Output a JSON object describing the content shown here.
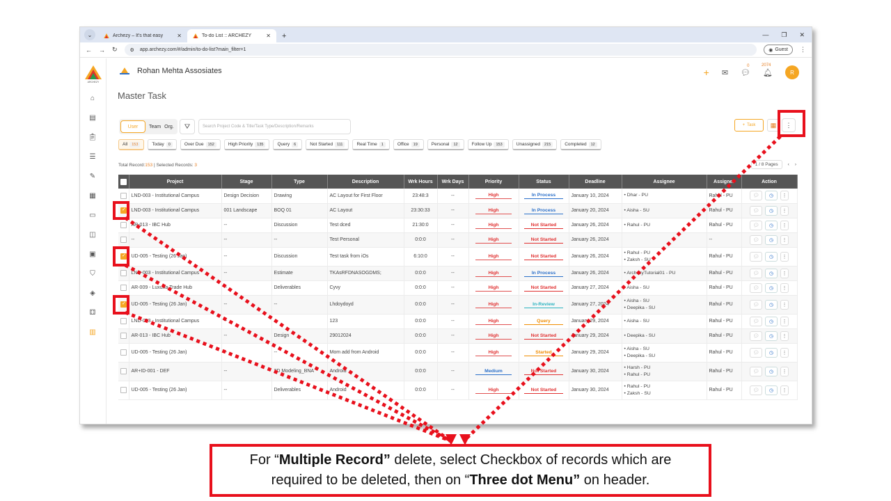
{
  "browser": {
    "tabs": [
      {
        "label": "Archezy – It's that easy",
        "active": false
      },
      {
        "label": "To-do List :: ARCHEZY",
        "active": true
      }
    ],
    "url": "app.archezy.com/#/admin/to-do-list?main_filter=1",
    "profile": "Guest"
  },
  "header": {
    "org_name": "Rohan Mehta Assosiates",
    "chat_badge": "0",
    "notif_badge": "2074",
    "avatar_initial": "R",
    "logo_text": "ARCHEZY"
  },
  "page": {
    "title": "Master Task",
    "toggle": [
      "User",
      "Team",
      "Org."
    ],
    "search_placeholder": "Search Project Code & Title/Task Type/Description/Remarks",
    "add_task": "Task",
    "filters": [
      {
        "label": "All",
        "count": "153",
        "active": true
      },
      {
        "label": "Today",
        "count": "0"
      },
      {
        "label": "Over Due",
        "count": "152"
      },
      {
        "label": "High Priority",
        "count": "135"
      },
      {
        "label": "Query",
        "count": "6"
      },
      {
        "label": "Not Started",
        "count": "111"
      },
      {
        "label": "Real Time",
        "count": "1"
      },
      {
        "label": "Office",
        "count": "19"
      },
      {
        "label": "Personal",
        "count": "12"
      },
      {
        "label": "Follow Up",
        "count": "153"
      },
      {
        "label": "Unassigned",
        "count": "215"
      },
      {
        "label": "Completed",
        "count": "12"
      }
    ],
    "total_label": "Total Record:",
    "total_value": "153",
    "selected_label": " | Selected Records: ",
    "selected_value": "3",
    "pager": "1 / 8 Pages"
  },
  "table": {
    "columns": [
      "Project",
      "Stage",
      "Type",
      "Description",
      "Wrk Hours",
      "Wrk Days",
      "Priority",
      "Status",
      "Deadline",
      "Assignee",
      "Assigner",
      "Action"
    ],
    "rows": [
      {
        "checked": false,
        "project": "LND-003 - Institutional Campus",
        "stage": "Design Decision",
        "type": "Drawing",
        "desc": "AC Layout for First Floor",
        "hours": "23:48:3",
        "days": "--",
        "priority": "High",
        "status": "In Process",
        "deadline": "January 10, 2024",
        "assignee": [
          "Dhar - PU"
        ],
        "assigner": "Rahul - PU"
      },
      {
        "checked": true,
        "project": "LND-003 - Institutional Campus",
        "stage": "001 Landscape",
        "type": "BOQ 01",
        "desc": "AC Layout",
        "hours": "23:30:33",
        "days": "--",
        "priority": "High",
        "status": "In Process",
        "deadline": "January 20, 2024",
        "assignee": [
          "Aisha - SU"
        ],
        "assigner": "Rahul - PU"
      },
      {
        "checked": false,
        "project": "AR-013 - IBC Hub",
        "stage": "--",
        "type": "Discussion",
        "desc": "Test dced",
        "hours": "21:30:0",
        "days": "--",
        "priority": "High",
        "status": "Not Started",
        "deadline": "January 26, 2024",
        "assignee": [
          "Rahul - PU"
        ],
        "assigner": "Rahul - PU"
      },
      {
        "checked": false,
        "project": "--",
        "stage": "--",
        "type": "--",
        "desc": "Test Personal",
        "hours": "0:0:0",
        "days": "--",
        "priority": "High",
        "status": "Not Started",
        "deadline": "January 26, 2024",
        "assignee": [],
        "assigner": "--"
      },
      {
        "checked": true,
        "project": "UD-005 - Testing (26 Jan)",
        "stage": "--",
        "type": "Discussion",
        "desc": "Test task from iOs",
        "hours": "6:10:0",
        "days": "--",
        "priority": "High",
        "status": "Not Started",
        "deadline": "January 26, 2024",
        "assignee": [
          "Rahul - PU",
          "Zaksh - SU"
        ],
        "assigner": "Rahul - PU"
      },
      {
        "checked": false,
        "project": "LND-003 - Institutional Campus",
        "stage": "--",
        "type": "Estimate",
        "desc": "TKAsRFDNASOGDMS;",
        "hours": "0:0:0",
        "days": "--",
        "priority": "High",
        "status": "In Process",
        "deadline": "January 26, 2024",
        "assignee": [
          "ArchezyTutorial01 - PU"
        ],
        "assigner": "Rahul - PU"
      },
      {
        "checked": false,
        "project": "AR-009 - Luxuria Trade Hub",
        "stage": "--",
        "type": "Deliverables",
        "desc": "Cyvy",
        "hours": "0:0:0",
        "days": "--",
        "priority": "High",
        "status": "Not Started",
        "deadline": "January 27, 2024",
        "assignee": [
          "Aisha - SU"
        ],
        "assigner": "Rahul - PU"
      },
      {
        "checked": true,
        "project": "UD-005 - Testing (26 Jan)",
        "stage": "--",
        "type": "--",
        "desc": "Lhdoydoyd",
        "hours": "0:0:0",
        "days": "--",
        "priority": "High",
        "status": "In-Review",
        "deadline": "January 27, 2024",
        "assignee": [
          "Aisha - SU",
          "Deepika - SU"
        ],
        "assigner": "Rahul - PU"
      },
      {
        "checked": false,
        "project": "LND-003 - Institutional Campus",
        "stage": "--",
        "type": "",
        "desc": "123",
        "hours": "0:0:0",
        "days": "--",
        "priority": "High",
        "status": "Query",
        "deadline": "January 29, 2024",
        "assignee": [
          "Aisha - SU"
        ],
        "assigner": "Rahul - PU"
      },
      {
        "checked": false,
        "project": "AR-013 - IBC Hub",
        "stage": "--",
        "type": "Design",
        "desc": "29012024",
        "hours": "0:0:0",
        "days": "--",
        "priority": "High",
        "status": "Not Started",
        "deadline": "January 29, 2024",
        "assignee": [
          "Deepika - SU"
        ],
        "assigner": "Rahul - PU"
      },
      {
        "checked": false,
        "project": "UD-005 - Testing (26 Jan)",
        "stage": "--",
        "type": "--",
        "desc": "Mom add from Android",
        "hours": "0:0:0",
        "days": "--",
        "priority": "High",
        "status": "Started",
        "deadline": "January 29, 2024",
        "assignee": [
          "Aisha - SU",
          "Deepika - SU"
        ],
        "assigner": "Rahul - PU"
      },
      {
        "checked": false,
        "project": "AR+ID-001 - DEF",
        "stage": "--",
        "type": "3D Modeling_BNA",
        "desc": "Android",
        "hours": "0:0:0",
        "days": "--",
        "priority": "Medium",
        "status": "Not Started",
        "deadline": "January 30, 2024",
        "assignee": [
          "Harsh - PU",
          "Rahul - PU"
        ],
        "assigner": "Rahul - PU"
      },
      {
        "checked": false,
        "project": "UD-005 - Testing (26 Jan)",
        "stage": "--",
        "type": "Deliverables",
        "desc": "Android",
        "hours": "0:0:0",
        "days": "--",
        "priority": "High",
        "status": "Not Started",
        "deadline": "January 30, 2024",
        "assignee": [
          "Rahul - PU",
          "Zaksh - SU"
        ],
        "assigner": "Rahul - PU"
      }
    ]
  },
  "callout": {
    "part1": "For “",
    "bold1": "Multiple Record”",
    "part2": " delete, select Checkbox of records which are required to be deleted, then on “",
    "bold2": "Three dot Menu”",
    "part3": " on header."
  },
  "colors": {
    "accent": "#f5a623",
    "annotation": "#e8101c",
    "header_bg": "#555555"
  }
}
